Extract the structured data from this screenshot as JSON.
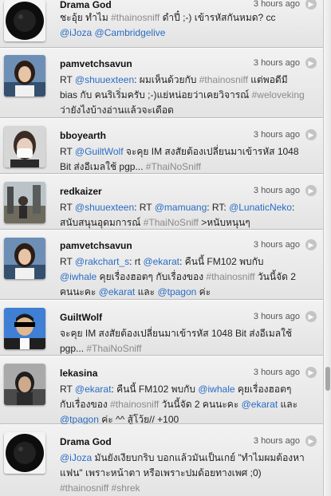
{
  "tweets": [
    {
      "user": "Drama God",
      "time": "3 hours ago",
      "avatar": "dark-circle",
      "lines": [
        [
          {
            "t": "ชะอุ้ย ทำไม "
          },
          {
            "t": "#thainosniff",
            "k": "hashtag"
          },
          {
            "t": " ดำปี๋ ;-) เข้ารหัสกันหมด? cc"
          }
        ],
        [
          {
            "t": "@iJoza",
            "k": "mention"
          },
          {
            "t": " "
          },
          {
            "t": "@Cambridgelive",
            "k": "mention"
          }
        ]
      ]
    },
    {
      "user": "pamvetchsavun",
      "time": "3 hours ago",
      "avatar": "portrait-woman",
      "lines": [
        [
          {
            "t": "RT "
          },
          {
            "t": "@shuuexteen",
            "k": "mention"
          },
          {
            "t": ": ผมเห็นด้วยกับ "
          },
          {
            "t": "#thainosniff",
            "k": "hashtag"
          },
          {
            "t": " แต่พอดีมี"
          }
        ],
        [
          {
            "t": "bias กับ คนริเริ่มครับ ;-)แย่หน่อยว่าเคยวิจารณ์ "
          },
          {
            "t": "#weloveking",
            "k": "hashtag"
          }
        ],
        [
          {
            "t": "ว่ายังไงบ้างอ่านแล้วจะเดือด"
          }
        ]
      ]
    },
    {
      "user": "bboyearth",
      "time": "3 hours ago",
      "avatar": "masked-face",
      "lines": [
        [
          {
            "t": "RT "
          },
          {
            "t": "@GuiltWolf",
            "k": "mention"
          },
          {
            "t": " จะคุย IM สงสัยต้องเปลี่ยนมาเข้ารหัส 1048"
          }
        ],
        [
          {
            "t": "Bit ส่งอีเมลใช้ pgp... "
          },
          {
            "t": "#ThaiNoSniff",
            "k": "hashtag"
          }
        ]
      ]
    },
    {
      "user": "redkaizer",
      "time": "3 hours ago",
      "avatar": "outdoor-scene",
      "lines": [
        [
          {
            "t": "RT "
          },
          {
            "t": "@shuuexteen",
            "k": "mention"
          },
          {
            "t": ": RT "
          },
          {
            "t": "@mamuang",
            "k": "mention"
          },
          {
            "t": ": RT: "
          },
          {
            "t": "@LunaticNeko",
            "k": "mention"
          },
          {
            "t": ":"
          }
        ],
        [
          {
            "t": "สนับสนุนอุดมการณ์ "
          },
          {
            "t": "#ThaiNoSniff",
            "k": "hashtag"
          },
          {
            "t": " >หนับหนุนๆ"
          }
        ]
      ]
    },
    {
      "user": "pamvetchsavun",
      "time": "3 hours ago",
      "avatar": "portrait-woman",
      "lines": [
        [
          {
            "t": "RT "
          },
          {
            "t": "@rakchart_s",
            "k": "mention"
          },
          {
            "t": ": rt "
          },
          {
            "t": "@ekarat",
            "k": "mention"
          },
          {
            "t": ": คืนนี้ FM102 พบกับ"
          }
        ],
        [
          {
            "t": "@iwhale",
            "k": "mention"
          },
          {
            "t": " คุยเรื่องฮอตๆ กับเรื่องของ "
          },
          {
            "t": "#thainosniff",
            "k": "hashtag"
          },
          {
            "t": " วันนี้จัด 2"
          }
        ],
        [
          {
            "t": "คนนะคะ "
          },
          {
            "t": "@ekarat",
            "k": "mention"
          },
          {
            "t": " และ "
          },
          {
            "t": "@tpagon",
            "k": "mention"
          },
          {
            "t": " ค่ะ"
          }
        ]
      ]
    },
    {
      "user": "GuiltWolf",
      "time": "3 hours ago",
      "avatar": "censored-portrait",
      "lines": [
        [
          {
            "t": "จะคุย IM สงสัยต้องเปลี่ยนมาเข้ารหัส 1048 Bit ส่งอีเมลใช้"
          }
        ],
        [
          {
            "t": "pgp... "
          },
          {
            "t": "#ThaiNoSniff",
            "k": "hashtag"
          }
        ]
      ]
    },
    {
      "user": "lekasina",
      "time": "3 hours ago",
      "avatar": "portrait-man",
      "lines": [
        [
          {
            "t": "RT "
          },
          {
            "t": "@ekarat",
            "k": "mention"
          },
          {
            "t": ": คืนนี้ FM102 พบกับ "
          },
          {
            "t": "@iwhale",
            "k": "mention"
          },
          {
            "t": " คุยเรื่องฮอตๆ"
          }
        ],
        [
          {
            "t": "กับเรื่องของ "
          },
          {
            "t": "#thainosniff",
            "k": "hashtag"
          },
          {
            "t": " วันนี้จัด 2 คนนะคะ "
          },
          {
            "t": "@ekarat",
            "k": "mention"
          },
          {
            "t": " และ"
          }
        ],
        [
          {
            "t": "@tpagon",
            "k": "mention"
          },
          {
            "t": " ค่ะ ^^ สู้โว้ย// +100"
          }
        ]
      ]
    },
    {
      "user": "Drama God",
      "time": "3 hours ago",
      "avatar": "dark-circle",
      "lines": [
        [
          {
            "t": "@iJoza",
            "k": "mention"
          },
          {
            "t": " มันยังเงียบกริบ บอกแล้วมันเป็นเกย์ \"ทำไมผมต้องหา"
          }
        ],
        [
          {
            "t": "แฟน\" เพราะหน้าตา หรือเพราะปมด้อยทางเพศ ;0)"
          }
        ],
        [
          {
            "t": "#thainosniff",
            "k": "hashtag"
          },
          {
            "t": " "
          },
          {
            "t": "#shrek",
            "k": "hashtag"
          }
        ]
      ]
    }
  ]
}
